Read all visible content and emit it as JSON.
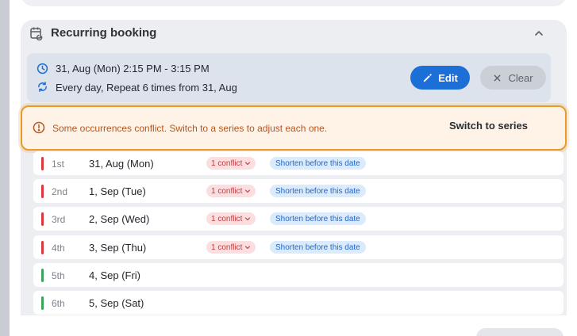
{
  "section": {
    "title": "Recurring booking",
    "icons": {
      "calendar": "calendar-repeat-icon",
      "collapse": "chevron-up-icon"
    }
  },
  "summary": {
    "time_range": "31, Aug (Mon) 2:15 PM - 3:15 PM",
    "recurrence": "Every day, Repeat 6 times from 31, Aug",
    "edit_label": "Edit",
    "clear_label": "Clear"
  },
  "warning": {
    "message": "Some occurrences conflict. Switch to a series to adjust each one.",
    "action_label": "Switch to series"
  },
  "occurrences": [
    {
      "ordinal": "1st",
      "date": "31, Aug (Mon)",
      "status": "conflict",
      "conflict_label": "1 conflict",
      "shorten_label": "Shorten before this date"
    },
    {
      "ordinal": "2nd",
      "date": "1, Sep (Tue)",
      "status": "conflict",
      "conflict_label": "1 conflict",
      "shorten_label": "Shorten before this date"
    },
    {
      "ordinal": "3rd",
      "date": "2, Sep (Wed)",
      "status": "conflict",
      "conflict_label": "1 conflict",
      "shorten_label": "Shorten before this date"
    },
    {
      "ordinal": "4th",
      "date": "3, Sep (Thu)",
      "status": "conflict",
      "conflict_label": "1 conflict",
      "shorten_label": "Shorten before this date"
    },
    {
      "ordinal": "5th",
      "date": "4, Sep (Fri)",
      "status": "ok"
    },
    {
      "ordinal": "6th",
      "date": "5, Sep (Sat)",
      "status": "ok"
    }
  ],
  "colors": {
    "accent": "#1d6fd8",
    "warning_border": "#e89a2c",
    "conflict": "#d9393d",
    "ok": "#3aa55a"
  }
}
